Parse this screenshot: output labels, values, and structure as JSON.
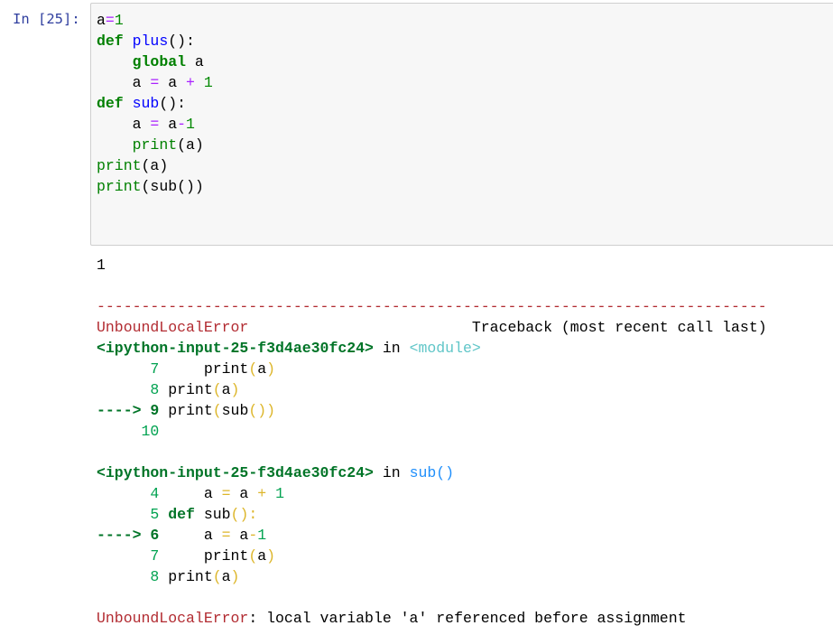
{
  "cell": {
    "prompt": "In [25]:",
    "code_lines": [
      "a=1",
      "def plus():",
      "    global a",
      "    a = a + 1",
      "def sub():",
      "    a = a-1",
      "    print(a)",
      "print(a)",
      "print(sub())"
    ]
  },
  "output": {
    "stdout": "1",
    "separator": "---------------------------------------------------------------------------",
    "error_name": "UnboundLocalError",
    "traceback_header": "Traceback (most recent call last)",
    "frames": [
      {
        "location": "<ipython-input-25-f3d4ae30fc24>",
        "in_word": "in",
        "scope": "<module>",
        "lines": [
          {
            "marker": "      7",
            "code": "     print(a)"
          },
          {
            "marker": "      8",
            "code": " print(a)"
          },
          {
            "marker": "----> 9",
            "code": " print(sub())"
          },
          {
            "marker": "     10",
            "code": ""
          }
        ]
      },
      {
        "location": "<ipython-input-25-f3d4ae30fc24>",
        "in_word": "in",
        "scope": "sub()",
        "lines": [
          {
            "marker": "      4",
            "code": "     a = a + 1"
          },
          {
            "marker": "      5",
            "code": " def sub():"
          },
          {
            "marker": "----> 6",
            "code": "     a = a-1"
          },
          {
            "marker": "      7",
            "code": "     print(a)"
          },
          {
            "marker": "      8",
            "code": " print(a)"
          }
        ]
      }
    ],
    "final_error_name": "UnboundLocalError",
    "final_message": ": local variable 'a' referenced before assignment"
  }
}
